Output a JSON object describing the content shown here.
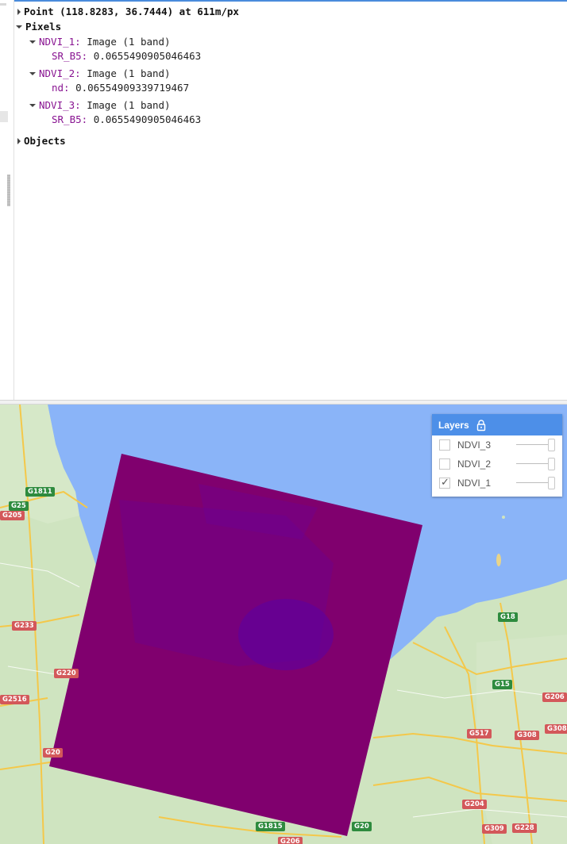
{
  "inspector": {
    "point": {
      "label": "Point (118.8283, 36.7444) at 611m/px"
    },
    "pixels": {
      "label": "Pixels",
      "entries": [
        {
          "name": "NDVI_1:",
          "type": "Image (1 band)",
          "band": "SR_B5:",
          "value": "0.0655490905046463"
        },
        {
          "name": "NDVI_2:",
          "type": "Image (1 band)",
          "band": "nd:",
          "value": "0.06554909339719467"
        },
        {
          "name": "NDVI_3:",
          "type": "Image (1 band)",
          "band": "SR_B5:",
          "value": "0.0655490905046463"
        }
      ]
    },
    "objects": {
      "label": "Objects"
    }
  },
  "layers": {
    "title": "Layers",
    "items": [
      {
        "name": "NDVI_3",
        "checked": false,
        "opacity": 1.0
      },
      {
        "name": "NDVI_2",
        "checked": false,
        "opacity": 1.0
      },
      {
        "name": "NDVI_1",
        "checked": true,
        "opacity": 1.0
      }
    ],
    "check_glyph": "✓"
  },
  "map": {
    "overlay_color": "#80006e",
    "water_color": "#8ab4f8",
    "land_color": "#cfe4c0",
    "road_labels_green": [
      "G1811",
      "G25",
      "G18",
      "G15",
      "G1815",
      "G20"
    ],
    "road_labels_red": [
      "G205",
      "G233",
      "G220",
      "G2516",
      "G206",
      "G308",
      "G517",
      "G308",
      "G204",
      "G309",
      "G228",
      "G206",
      "G20"
    ]
  }
}
